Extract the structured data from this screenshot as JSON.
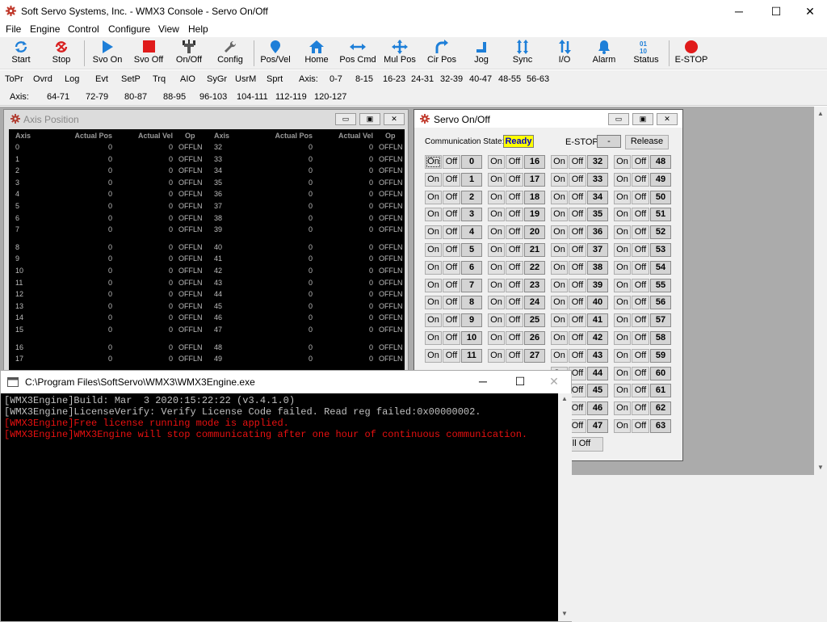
{
  "app": {
    "title": "Soft Servo Systems, Inc. - WMX3 Console - Servo On/Off"
  },
  "menu": [
    "File",
    "Engine",
    "Control",
    "Configure",
    "View",
    "Help"
  ],
  "toolbar": [
    {
      "label": "Start",
      "icon": "refresh-icon"
    },
    {
      "label": "Stop",
      "icon": "stop-refresh-icon"
    },
    {
      "label": "Svo On",
      "icon": "play-icon"
    },
    {
      "label": "Svo Off",
      "icon": "red-square-icon"
    },
    {
      "label": "On/Off",
      "icon": "plug-icon"
    },
    {
      "label": "Config",
      "icon": "wrench-icon"
    },
    {
      "label": "Pos/Vel",
      "icon": "pin-icon"
    },
    {
      "label": "Home",
      "icon": "home-icon"
    },
    {
      "label": "Pos Cmd",
      "icon": "arrows-horizontal-icon"
    },
    {
      "label": "Mul Pos",
      "icon": "arrows-cross-icon"
    },
    {
      "label": "Cir Pos",
      "icon": "curve-arrow-icon"
    },
    {
      "label": "Jog",
      "icon": "jog-icon"
    },
    {
      "label": "Sync",
      "icon": "sync-arrows-icon"
    },
    {
      "label": "I/O",
      "icon": "io-arrows-icon"
    },
    {
      "label": "Alarm",
      "icon": "bell-icon"
    },
    {
      "label": "Status",
      "icon": "binary-icon"
    },
    {
      "label": "E-STOP",
      "icon": "estop-icon"
    }
  ],
  "subbar1": [
    "ToPr",
    "Ovrd",
    "Log",
    "Evt",
    "SetP",
    "Trq",
    "AIO",
    "SyGr",
    "UsrM",
    "Sprt",
    "Axis:",
    "0-7",
    "8-15",
    "16-23",
    "24-31",
    "32-39",
    "40-47",
    "48-55",
    "56-63"
  ],
  "subbar2": [
    "Axis:",
    "64-71",
    "72-79",
    "80-87",
    "88-95",
    "96-103",
    "104-111",
    "112-119",
    "120-127"
  ],
  "axis_window": {
    "title": "Axis Position",
    "headers": [
      "Axis",
      "Actual Pos",
      "Actual Vel",
      "Op",
      "Axis",
      "Actual Pos",
      "Actual Vel",
      "Op"
    ],
    "rows": [
      {
        "a": "0",
        "p": "0",
        "v": "0",
        "o": "OFFLN",
        "b": "32",
        "p2": "0",
        "v2": "0",
        "o2": "OFFLN"
      },
      {
        "a": "1",
        "p": "0",
        "v": "0",
        "o": "OFFLN",
        "b": "33",
        "p2": "0",
        "v2": "0",
        "o2": "OFFLN"
      },
      {
        "a": "2",
        "p": "0",
        "v": "0",
        "o": "OFFLN",
        "b": "34",
        "p2": "0",
        "v2": "0",
        "o2": "OFFLN"
      },
      {
        "a": "3",
        "p": "0",
        "v": "0",
        "o": "OFFLN",
        "b": "35",
        "p2": "0",
        "v2": "0",
        "o2": "OFFLN"
      },
      {
        "a": "4",
        "p": "0",
        "v": "0",
        "o": "OFFLN",
        "b": "36",
        "p2": "0",
        "v2": "0",
        "o2": "OFFLN"
      },
      {
        "a": "5",
        "p": "0",
        "v": "0",
        "o": "OFFLN",
        "b": "37",
        "p2": "0",
        "v2": "0",
        "o2": "OFFLN"
      },
      {
        "a": "6",
        "p": "0",
        "v": "0",
        "o": "OFFLN",
        "b": "38",
        "p2": "0",
        "v2": "0",
        "o2": "OFFLN"
      },
      {
        "a": "7",
        "p": "0",
        "v": "0",
        "o": "OFFLN",
        "b": "39",
        "p2": "0",
        "v2": "0",
        "o2": "OFFLN"
      },
      {
        "a": "8",
        "p": "0",
        "v": "0",
        "o": "OFFLN",
        "b": "40",
        "p2": "0",
        "v2": "0",
        "o2": "OFFLN"
      },
      {
        "a": "9",
        "p": "0",
        "v": "0",
        "o": "OFFLN",
        "b": "41",
        "p2": "0",
        "v2": "0",
        "o2": "OFFLN"
      },
      {
        "a": "10",
        "p": "0",
        "v": "0",
        "o": "OFFLN",
        "b": "42",
        "p2": "0",
        "v2": "0",
        "o2": "OFFLN"
      },
      {
        "a": "11",
        "p": "0",
        "v": "0",
        "o": "OFFLN",
        "b": "43",
        "p2": "0",
        "v2": "0",
        "o2": "OFFLN"
      },
      {
        "a": "12",
        "p": "0",
        "v": "0",
        "o": "OFFLN",
        "b": "44",
        "p2": "0",
        "v2": "0",
        "o2": "OFFLN"
      },
      {
        "a": "13",
        "p": "0",
        "v": "0",
        "o": "OFFLN",
        "b": "45",
        "p2": "0",
        "v2": "0",
        "o2": "OFFLN"
      },
      {
        "a": "14",
        "p": "0",
        "v": "0",
        "o": "OFFLN",
        "b": "46",
        "p2": "0",
        "v2": "0",
        "o2": "OFFLN"
      },
      {
        "a": "15",
        "p": "0",
        "v": "0",
        "o": "OFFLN",
        "b": "47",
        "p2": "0",
        "v2": "0",
        "o2": "OFFLN"
      },
      {
        "a": "16",
        "p": "0",
        "v": "0",
        "o": "OFFLN",
        "b": "48",
        "p2": "0",
        "v2": "0",
        "o2": "OFFLN"
      },
      {
        "a": "17",
        "p": "0",
        "v": "0",
        "o": "OFFLN",
        "b": "49",
        "p2": "0",
        "v2": "0",
        "o2": "OFFLN"
      }
    ]
  },
  "servo_window": {
    "title": "Servo On/Off",
    "comm_label": "Communication State:",
    "comm_value": "Ready",
    "estop_label": "E-STOP:",
    "estop_value": "-",
    "release_label": "Release",
    "on_label": "On",
    "off_label": "Off",
    "all_off_label": "ll Off",
    "columns": [
      [
        "0",
        "1",
        "2",
        "3",
        "4",
        "5",
        "6",
        "7",
        "8",
        "9",
        "10",
        "11"
      ],
      [
        "16",
        "17",
        "18",
        "19",
        "20",
        "21",
        "22",
        "23",
        "24",
        "25",
        "26",
        "27"
      ],
      [
        "32",
        "33",
        "34",
        "35",
        "36",
        "37",
        "38",
        "39",
        "40",
        "41",
        "42",
        "43",
        "44",
        "45",
        "46",
        "47"
      ],
      [
        "48",
        "49",
        "50",
        "51",
        "52",
        "53",
        "54",
        "55",
        "56",
        "57",
        "58",
        "59",
        "60",
        "61",
        "62",
        "63"
      ]
    ],
    "colors": {
      "ready_bg": "#ffff00",
      "ready_fg": "#0000cc"
    }
  },
  "console": {
    "title": "C:\\Program Files\\SoftServo\\WMX3\\WMX3Engine.exe",
    "lines": [
      {
        "text": "[WMX3Engine]Build: Mar  3 2020:15:22:22 (v3.4.1.0)",
        "color": "#c0c0c0"
      },
      {
        "text": "[WMX3Engine]LicenseVerify: Verify License Code failed. Read reg failed:0x00000002.",
        "color": "#c0c0c0"
      },
      {
        "text": "[WMX3Engine]Free license running mode is applied.",
        "color": "#e81010"
      },
      {
        "text": "[WMX3Engine]WMX3Engine will stop communicating after one hour of continuous communication.",
        "color": "#e81010"
      }
    ]
  }
}
